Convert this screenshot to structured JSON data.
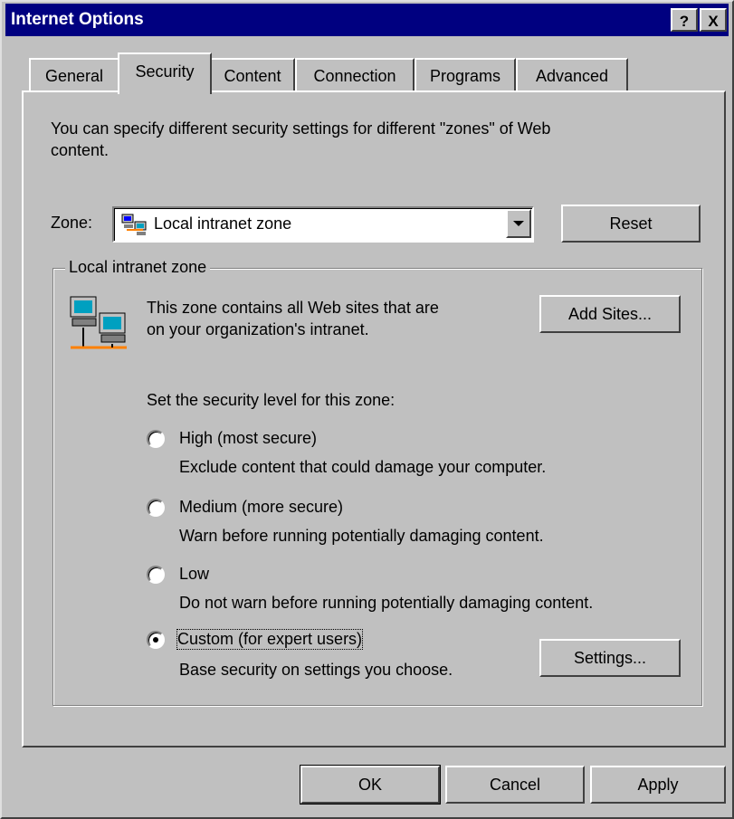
{
  "window": {
    "title": "Internet Options",
    "help_label": "?",
    "close_label": "X"
  },
  "tabs": [
    {
      "label": "General",
      "active": false
    },
    {
      "label": "Security",
      "active": true
    },
    {
      "label": "Content",
      "active": false
    },
    {
      "label": "Connection",
      "active": false
    },
    {
      "label": "Programs",
      "active": false
    },
    {
      "label": "Advanced",
      "active": false
    }
  ],
  "security": {
    "intro_line1": "You can specify different security settings for different \"zones\" of Web",
    "intro_line2": "content.",
    "zone_label": "Zone:",
    "zone_selected": "Local intranet zone",
    "zone_icon": "network-computers-icon",
    "reset_label": "Reset",
    "group_title": "Local intranet zone",
    "zone_desc_line1": "This zone contains all Web sites that are",
    "zone_desc_line2": "on your organization's intranet.",
    "add_sites_label": "Add Sites...",
    "level_prompt": "Set the security level for this zone:",
    "levels": [
      {
        "label": "High (most secure)",
        "desc": "Exclude content that could damage your computer.",
        "checked": false
      },
      {
        "label": "Medium (more secure)",
        "desc": "Warn before running potentially damaging content.",
        "checked": false
      },
      {
        "label": "Low",
        "desc": "Do not warn before running potentially damaging content.",
        "checked": false
      },
      {
        "label": "Custom (for expert users)",
        "desc": "Base security on settings you choose.",
        "checked": true
      }
    ],
    "settings_label": "Settings..."
  },
  "footer": {
    "ok_label": "OK",
    "cancel_label": "Cancel",
    "apply_label": "Apply"
  }
}
